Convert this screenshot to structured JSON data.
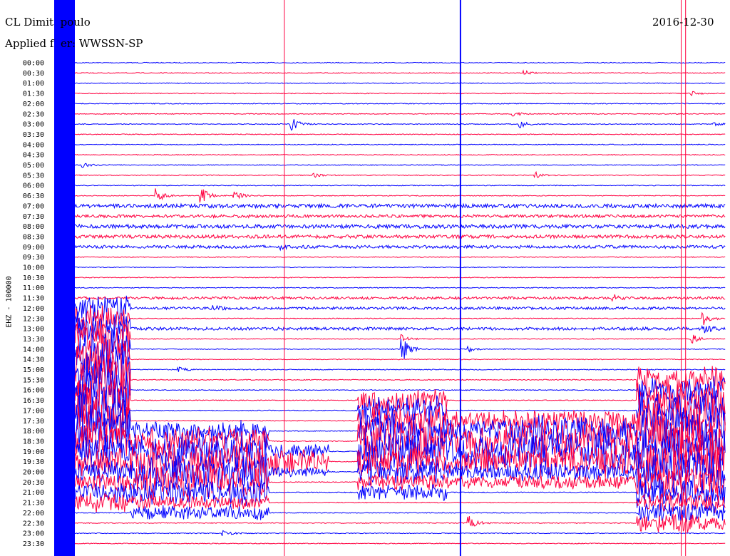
{
  "header": {
    "station": "CL Dimit  poulo",
    "filter": "Applied f  er: WWSSN-SP",
    "date": "2016-12-30"
  },
  "channel_label": "EHZ - 100000",
  "colors": {
    "trace_a": "#0000ff",
    "trace_b": "#ff0040",
    "text": "#000000"
  },
  "chart_data": {
    "type": "helicorder",
    "title": "",
    "xlabel": "",
    "ylabel": "EHZ - 100000",
    "row_labels": [
      "00:00",
      "00:30",
      "01:00",
      "01:30",
      "02:00",
      "02:30",
      "03:00",
      "03:30",
      "04:00",
      "04:30",
      "05:00",
      "05:30",
      "06:00",
      "06:30",
      "07:00",
      "07:30",
      "08:00",
      "08:30",
      "09:00",
      "09:30",
      "10:00",
      "10:30",
      "11:00",
      "11:30",
      "12:00",
      "12:30",
      "13:00",
      "13:30",
      "14:00",
      "14:30",
      "15:00",
      "15:30",
      "16:00",
      "16:30",
      "17:00",
      "17:30",
      "18:00",
      "18:30",
      "19:00",
      "19:30",
      "20:00",
      "20:30",
      "21:00",
      "21:30",
      "22:00",
      "22:30",
      "23:00",
      "23:30"
    ],
    "row_minutes": 30,
    "row_colors": [
      "blue",
      "red"
    ],
    "events": [
      {
        "row": "00:30",
        "minute": 21.0,
        "amp": 0.4
      },
      {
        "row": "01:30",
        "minute": 28.5,
        "amp": 0.4
      },
      {
        "row": "02:30",
        "minute": 20.5,
        "amp": 0.5
      },
      {
        "row": "03:00",
        "minute": 10.5,
        "amp": 1.6
      },
      {
        "row": "03:00",
        "minute": 20.8,
        "amp": 0.7
      },
      {
        "row": "03:00",
        "minute": 29.5,
        "amp": 0.5
      },
      {
        "row": "05:00",
        "minute": 1.2,
        "amp": 0.5
      },
      {
        "row": "05:30",
        "minute": 11.5,
        "amp": 0.6
      },
      {
        "row": "05:30",
        "minute": 21.5,
        "amp": 0.6
      },
      {
        "row": "06:30",
        "minute": 4.5,
        "amp": 1.4
      },
      {
        "row": "06:30",
        "minute": 6.5,
        "amp": 1.8
      },
      {
        "row": "06:30",
        "minute": 8.0,
        "amp": 1.0
      },
      {
        "row": "09:00",
        "minute": 10.0,
        "amp": 0.6
      },
      {
        "row": "11:30",
        "minute": 25.0,
        "amp": 0.6
      },
      {
        "row": "12:00",
        "minute": 7.0,
        "amp": 0.5
      },
      {
        "row": "12:30",
        "minute": 29.0,
        "amp": 1.3
      },
      {
        "row": "13:00",
        "minute": 29.0,
        "amp": 0.8
      },
      {
        "row": "13:30",
        "minute": 15.5,
        "amp": 0.8
      },
      {
        "row": "13:30",
        "minute": 28.5,
        "amp": 0.9
      },
      {
        "row": "14:00",
        "minute": 15.5,
        "amp": 2.6
      },
      {
        "row": "14:00",
        "minute": 18.5,
        "amp": 0.5
      },
      {
        "row": "15:00",
        "minute": 5.5,
        "amp": 0.5
      },
      {
        "row": "22:30",
        "minute": 18.5,
        "amp": 1.6
      },
      {
        "row": "23:00",
        "minute": 7.5,
        "amp": 0.6
      }
    ],
    "noisy_rows": [
      {
        "row": "07:00",
        "level": 0.35
      },
      {
        "row": "07:30",
        "level": 0.25
      },
      {
        "row": "08:00",
        "level": 0.35
      },
      {
        "row": "08:30",
        "level": 0.3
      },
      {
        "row": "09:00",
        "level": 0.25
      },
      {
        "row": "11:30",
        "level": 0.2
      },
      {
        "row": "12:00",
        "level": 0.2
      },
      {
        "row": "13:00",
        "level": 0.25
      }
    ],
    "bursts": [
      {
        "start": "12:00",
        "end": "21:30",
        "minute_from": 0.8,
        "minute_to": 3.3,
        "amp": 2.8
      },
      {
        "start": "18:00",
        "end": "22:00",
        "minute_from": 3.3,
        "minute_to": 9.5,
        "amp": 2.2
      },
      {
        "start": "19:00",
        "end": "20:00",
        "minute_from": 9.5,
        "minute_to": 12.2,
        "amp": 1.4
      },
      {
        "start": "16:30",
        "end": "21:00",
        "minute_from": 13.5,
        "minute_to": 17.5,
        "amp": 2.4
      },
      {
        "start": "17:30",
        "end": "20:30",
        "minute_from": 17.5,
        "minute_to": 20.0,
        "amp": 1.8
      },
      {
        "start": "17:30",
        "end": "20:30",
        "minute_from": 20.0,
        "minute_to": 26.0,
        "amp": 2.2
      },
      {
        "start": "15:30",
        "end": "22:30",
        "minute_from": 26.0,
        "minute_to": 30.0,
        "amp": 2.8
      }
    ],
    "spike_lines": [
      {
        "minute": 10.2,
        "color": "red"
      },
      {
        "minute": 18.1,
        "color": "blue"
      },
      {
        "minute": 28.0,
        "color": "red"
      },
      {
        "minute": 28.2,
        "color": "red"
      }
    ],
    "clipped_band": {
      "minute_from": 0.0,
      "minute_to": 0.8,
      "color": "blue"
    }
  }
}
